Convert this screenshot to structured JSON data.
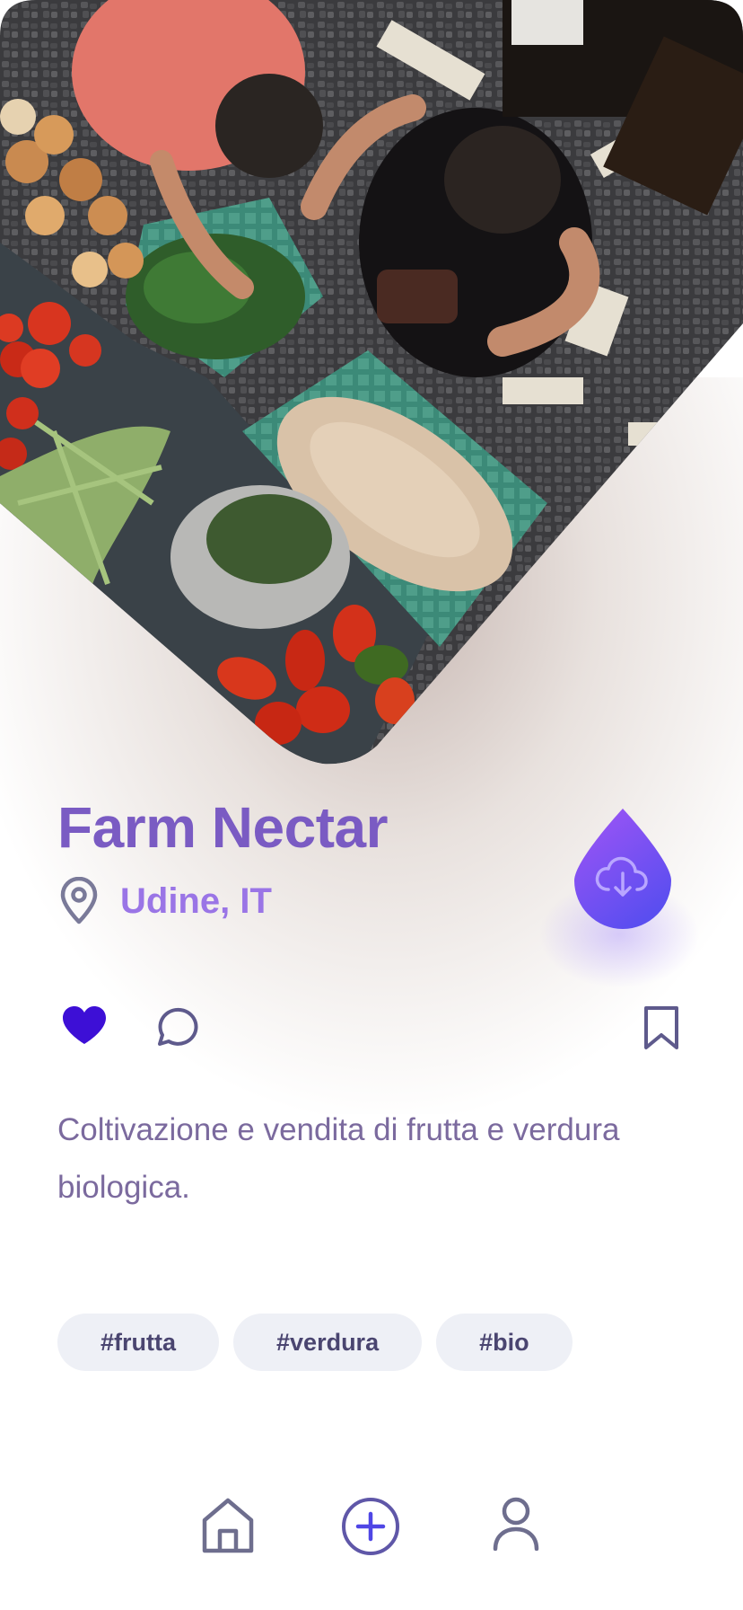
{
  "place": {
    "name": "Farm Nectar",
    "location": "Udine, IT",
    "description": "Coltivazione e vendita di frutta e verdura biologica."
  },
  "icons": {
    "location": "map-pin-icon",
    "download": "cloud-download-icon",
    "like": "heart-icon",
    "comment": "comment-icon",
    "bookmark": "bookmark-icon",
    "home": "home-icon",
    "add": "plus-circle-icon",
    "profile": "user-icon"
  },
  "actions": {
    "liked": true
  },
  "tags": [
    "#frutta",
    "#verdura",
    "#bio"
  ],
  "colors": {
    "title": "#7a5bc3",
    "location": "#9a75e6",
    "accent": "#3d0fd6",
    "fab_top": "#a155f5",
    "fab_bottom": "#5a4ef0",
    "icon": "#5e5a8c",
    "tag_bg": "#eef0f6"
  }
}
